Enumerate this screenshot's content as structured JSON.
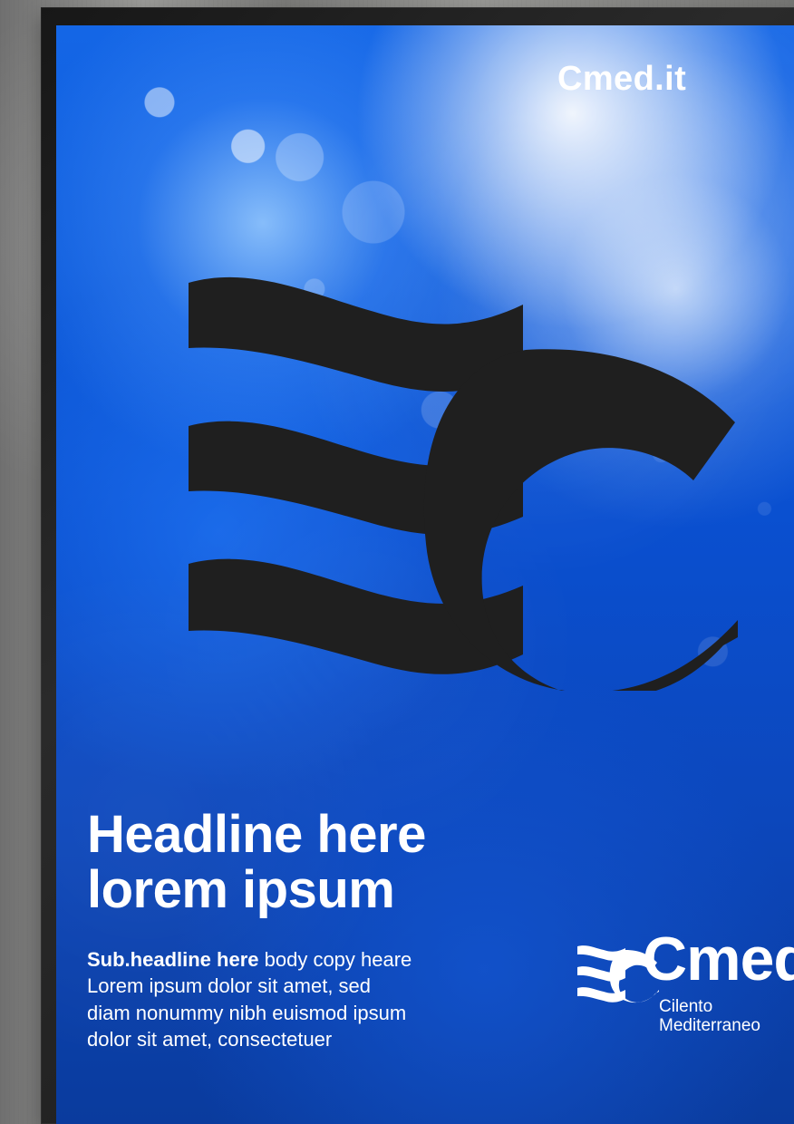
{
  "poster": {
    "url": "Cmed.it",
    "headline_lines": [
      "Headline here",
      "lorem ipsum"
    ],
    "subheadline_label": "Sub.headline here",
    "body_lines": [
      "body copy heare",
      "Lorem ipsum dolor sit amet, sed",
      "diam nonummy nibh euismod ipsum",
      "dolor sit amet, consectetuer"
    ],
    "brand": {
      "name": "Cmed",
      "subtitle_lines": [
        "Cilento",
        "Mediterraneo"
      ]
    }
  },
  "colors": {
    "wall": "#8d8d8b",
    "frame": "#1f1f1f",
    "poster_blue": "#0f5ddd",
    "mark_dark": "#1f1f1f",
    "text_white": "#ffffff"
  },
  "icons": {
    "hero_mark": "cmed-wave-c-logo-icon",
    "brand_mark": "cmed-wave-c-logo-icon"
  }
}
